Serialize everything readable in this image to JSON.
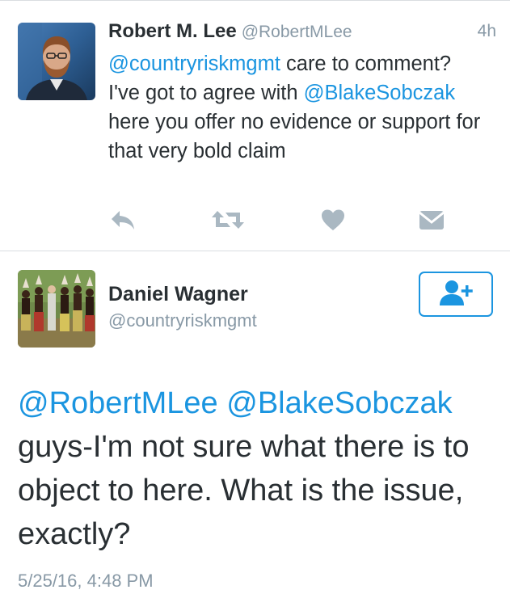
{
  "tweet1": {
    "name": "Robert M. Lee",
    "handle": "@RobertMLee",
    "time": "4h",
    "mention1": "@countryriskmgmt",
    "text1": " care to comment? I've got to agree with ",
    "mention2": "@BlakeSobczak",
    "text2": " here you offer no evidence or support for that very bold claim",
    "actions": [
      "reply-icon",
      "retweet-icon",
      "like-icon",
      "direct-message-icon"
    ]
  },
  "tweet2": {
    "name": "Daniel Wagner",
    "handle": "@countryriskmgmt",
    "follow_icon": "follow-user-icon",
    "mention1": "@RobertMLee",
    "mention2": "@BlakeSobczak",
    "text": "guys-I'm not sure what there is to object to here. What is the issue, exactly?",
    "date": "5/25/16, 4:48 PM"
  },
  "colors": {
    "mention": "#1b95e0",
    "secondary_text": "#8899a6",
    "icon": "#aab8c2",
    "divider": "#d9dde0"
  }
}
